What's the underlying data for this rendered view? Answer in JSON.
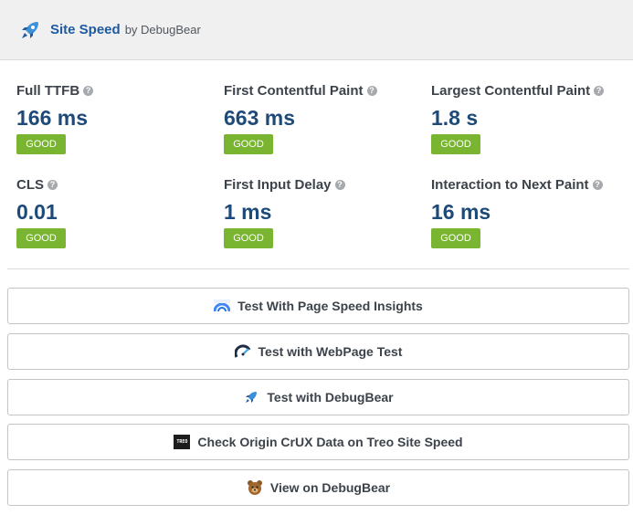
{
  "header": {
    "title": "Site Speed",
    "byline": "by DebugBear",
    "logo_icon": "rocket-icon",
    "brand_color": "#1e5aa0"
  },
  "metrics": [
    {
      "label": "Full TTFB",
      "value": "166 ms",
      "status": "GOOD",
      "help_icon": "question-icon"
    },
    {
      "label": "First Contentful Paint",
      "value": "663 ms",
      "status": "GOOD",
      "help_icon": "question-icon"
    },
    {
      "label": "Largest Contentful Paint",
      "value": "1.8 s",
      "status": "GOOD",
      "help_icon": "question-icon"
    },
    {
      "label": "CLS",
      "value": "0.01",
      "status": "GOOD",
      "help_icon": "question-icon"
    },
    {
      "label": "First Input Delay",
      "value": "1 ms",
      "status": "GOOD",
      "help_icon": "question-icon"
    },
    {
      "label": "Interaction to Next Paint",
      "value": "16 ms",
      "status": "GOOD",
      "help_icon": "question-icon"
    }
  ],
  "colors": {
    "good_badge": "#79b530",
    "metric_value": "#1d4a78"
  },
  "actions": [
    {
      "label": "Test With Page Speed Insights",
      "icon": "pagespeed-insights-icon"
    },
    {
      "label": "Test with WebPage Test",
      "icon": "webpagetest-icon"
    },
    {
      "label": "Test with DebugBear",
      "icon": "debugbear-rocket-icon"
    },
    {
      "label": "Check Origin CrUX Data on Treo Site Speed",
      "icon": "treo-icon",
      "icon_text": "TREO"
    },
    {
      "label": "View on DebugBear",
      "icon": "bear-icon"
    }
  ]
}
